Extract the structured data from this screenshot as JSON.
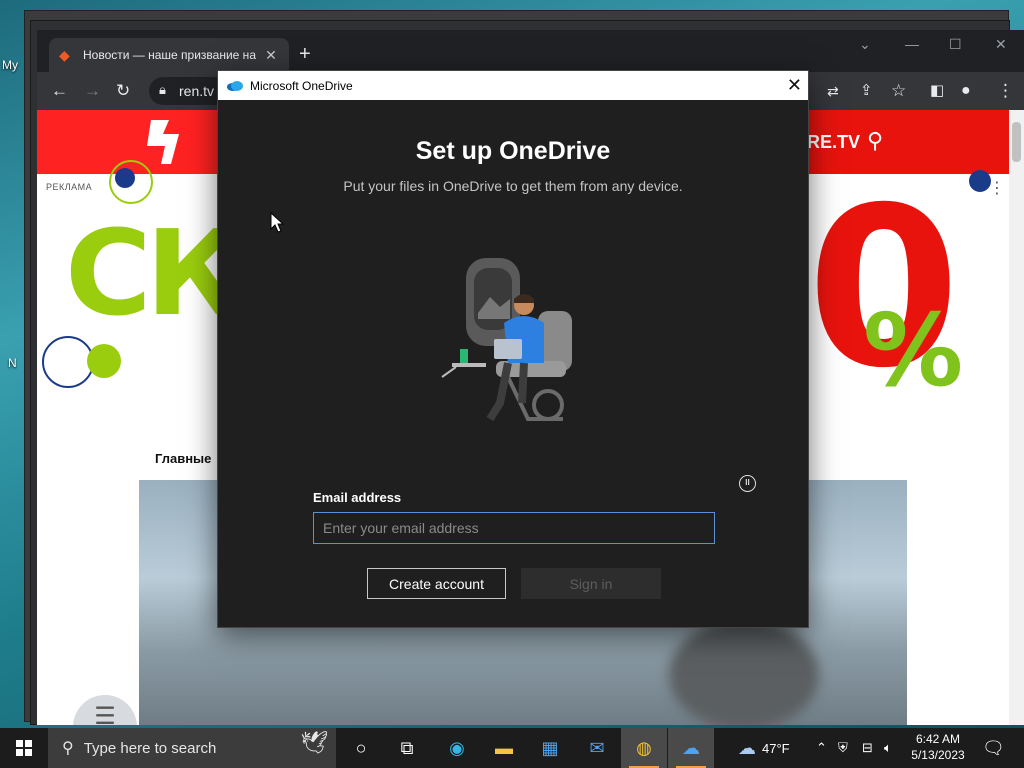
{
  "desktop": {
    "icon_labels": [
      "My",
      "N"
    ]
  },
  "browser": {
    "tab_title": "Новости — наше призвание на",
    "tab_close": "✕",
    "new_tab": "+",
    "address": "ren.tv",
    "window_controls": {
      "minimize": "—",
      "maximize": "☐",
      "close": "✕",
      "tabs_menu": "⌄"
    }
  },
  "website": {
    "brand": "RE.TV",
    "ad_label": "РЕКЛАМА",
    "ad_text": "СК",
    "ad_zero": "0",
    "ad_percent": "%",
    "section_title": "Главные",
    "fab_icon": "☰"
  },
  "dialog": {
    "window_title": "Microsoft OneDrive",
    "close_glyph": "✕",
    "heading": "Set up OneDrive",
    "subheading": "Put your files in OneDrive to get them from any device.",
    "pause_glyph": "II",
    "email_label": "Email address",
    "email_value": "",
    "email_placeholder": "Enter your email address",
    "create_account_label": "Create account",
    "sign_in_label": "Sign in"
  },
  "taskbar": {
    "search_placeholder": "Type here to search",
    "weather_temp": "47°F",
    "time": "6:42 AM",
    "date": "5/13/2023",
    "pinned_icons": [
      "cortana-icon",
      "task-view-icon",
      "edge-icon",
      "file-explorer-icon",
      "store-icon",
      "mail-icon",
      "chrome-icon",
      "onedrive-setup-icon"
    ]
  },
  "colors": {
    "accent": "#e8130d",
    "dialog_bg": "#1f1f1f",
    "input_border": "#5b8fd6",
    "ad_green": "#9acd0e"
  }
}
